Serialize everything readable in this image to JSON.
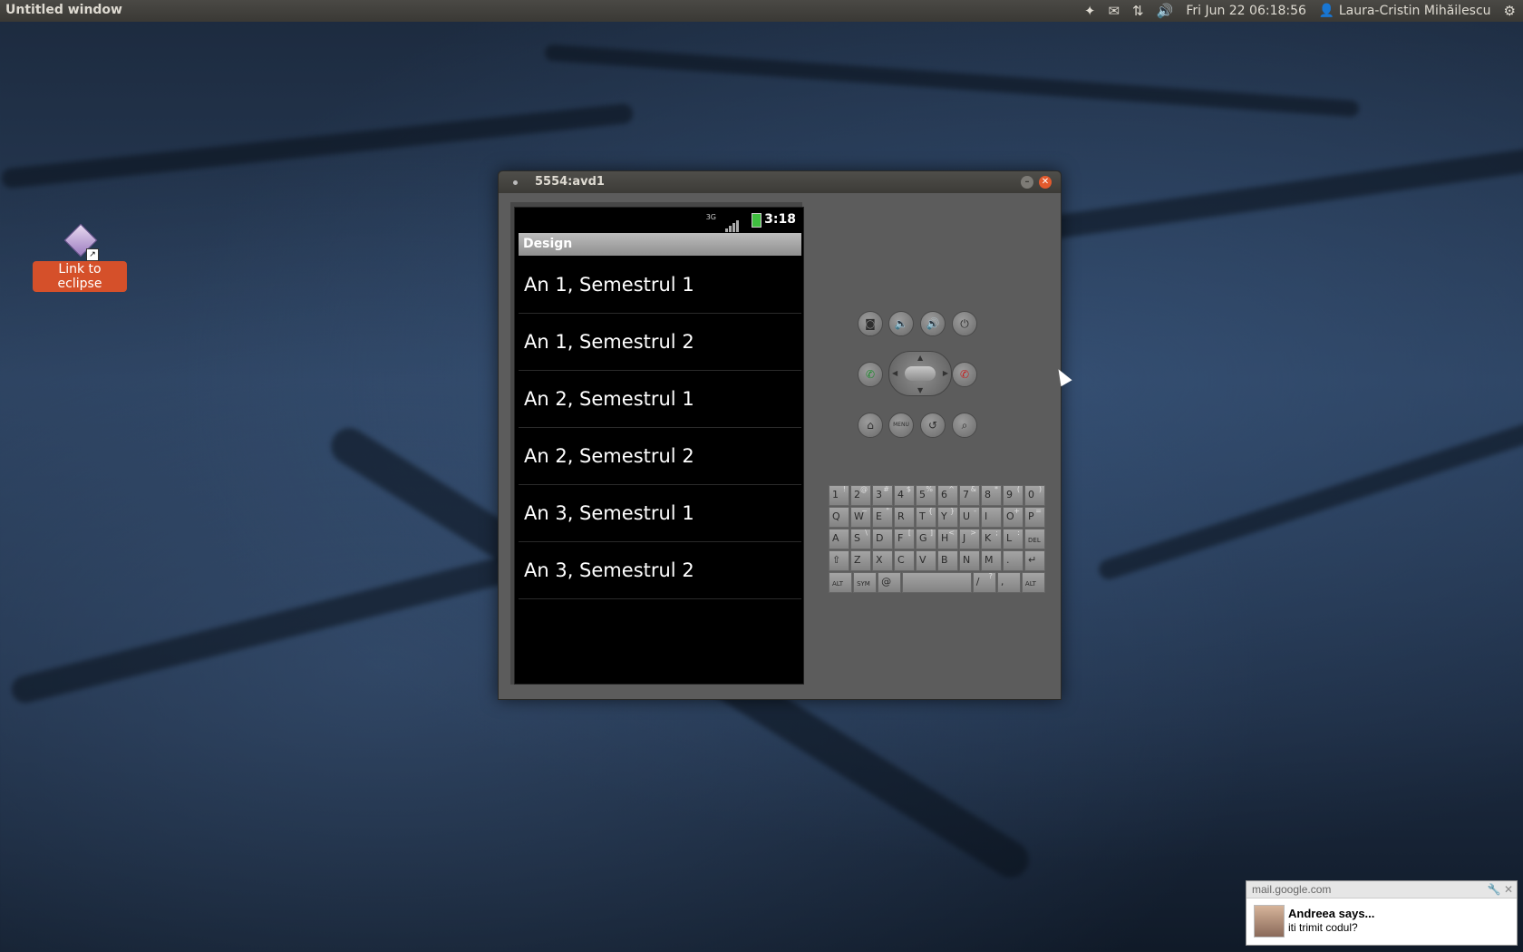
{
  "panel": {
    "window_title": "Untitled window",
    "datetime": "Fri Jun 22 06:18:56",
    "user": "Laura-Cristin Mihăilescu"
  },
  "desktop": {
    "icon_label": "Link to eclipse"
  },
  "emulator": {
    "window_title": "5554:avd1",
    "status_time": "3:18",
    "network_type": "3G",
    "app_title": "Design",
    "list_items": [
      "An 1, Semestrul 1",
      "An 1, Semestrul 2",
      "An 2, Semestrul 1",
      "An 2, Semestrul 2",
      "An 3, Semestrul 1",
      "An 3, Semestrul 2"
    ],
    "keyboard": {
      "row1": [
        [
          "1",
          "!"
        ],
        [
          "2",
          "@"
        ],
        [
          "3",
          "#"
        ],
        [
          "4",
          "$"
        ],
        [
          "5",
          "%"
        ],
        [
          "6",
          "^"
        ],
        [
          "7",
          "&"
        ],
        [
          "8",
          "*"
        ],
        [
          "9",
          "("
        ],
        [
          "0",
          ")"
        ]
      ],
      "row2": [
        [
          "Q",
          ""
        ],
        [
          "W",
          "~"
        ],
        [
          "E",
          "\""
        ],
        [
          "R",
          ""
        ],
        [
          "T",
          "{"
        ],
        [
          "Y",
          "}"
        ],
        [
          "U",
          "-"
        ],
        [
          "I",
          ""
        ],
        [
          "O",
          "+"
        ],
        [
          "P",
          "="
        ]
      ],
      "row3": [
        [
          "A",
          ""
        ],
        [
          "S",
          "\\"
        ],
        [
          "D",
          ""
        ],
        [
          "F",
          "["
        ],
        [
          "G",
          "]"
        ],
        [
          "H",
          "<"
        ],
        [
          "J",
          ">"
        ],
        [
          "K",
          ";"
        ],
        [
          "L",
          ":"
        ],
        [
          "DEL",
          ""
        ]
      ],
      "row4": [
        [
          "⇧",
          ""
        ],
        [
          "Z",
          ""
        ],
        [
          "X",
          ""
        ],
        [
          "C",
          ""
        ],
        [
          "V",
          ""
        ],
        [
          "B",
          ""
        ],
        [
          "N",
          ""
        ],
        [
          "M",
          ""
        ],
        [
          ".",
          ""
        ],
        [
          "↵",
          ""
        ]
      ],
      "row5_left": [
        "ALT",
        "SYM",
        "@"
      ],
      "row5_right": [
        "/",
        "?",
        ",",
        "ALT"
      ]
    }
  },
  "notification": {
    "source": "mail.google.com",
    "sender": "Andreea says...",
    "message": "iti trimit codul?"
  }
}
